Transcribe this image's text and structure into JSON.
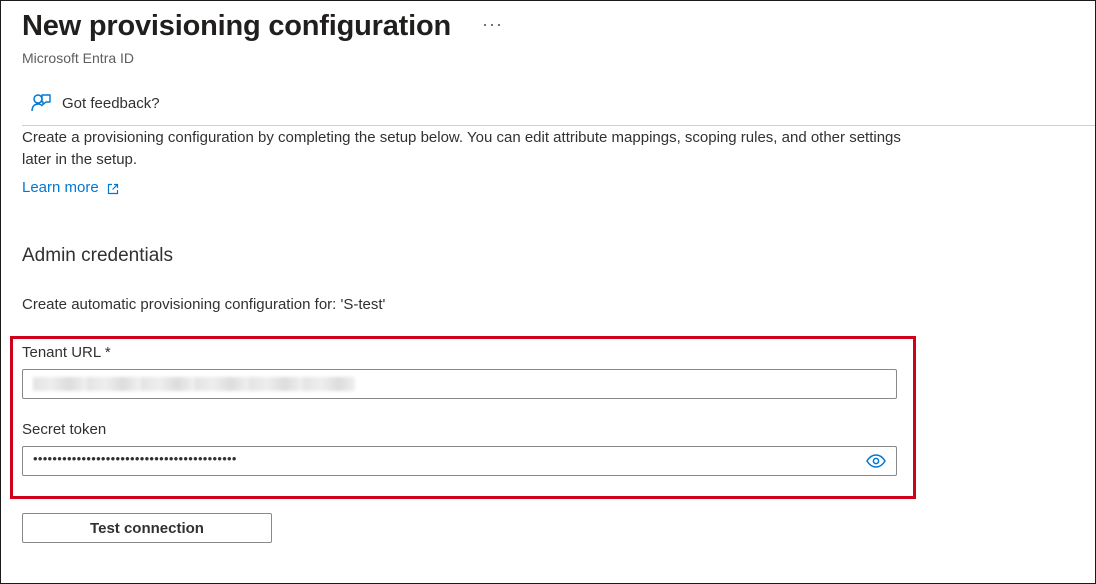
{
  "header": {
    "title": "New provisioning configuration",
    "more_label": "···",
    "subtitle": "Microsoft Entra ID"
  },
  "toolbar": {
    "feedback_icon": "person-feedback-icon",
    "feedback_label": "Got feedback?"
  },
  "intro": {
    "text": "Create a provisioning configuration by completing the setup below. You can edit attribute mappings, scoping rules, and other settings later in the setup.",
    "learn_more_label": "Learn more",
    "learn_more_icon": "external-link-icon"
  },
  "admin_credentials": {
    "heading": "Admin credentials",
    "config_for": "Create automatic provisioning configuration for: 'S-test'",
    "tenant_url": {
      "label": "Tenant URL *",
      "value": ""
    },
    "secret_token": {
      "label": "Secret token",
      "value": "••••••••••••••••••••••••••••••••••••••••••",
      "reveal_icon": "eye-icon"
    },
    "test_button_label": "Test connection"
  },
  "colors": {
    "accent": "#0078d4",
    "highlight": "#d0021b",
    "text": "#323130",
    "border": "#8a8886"
  }
}
